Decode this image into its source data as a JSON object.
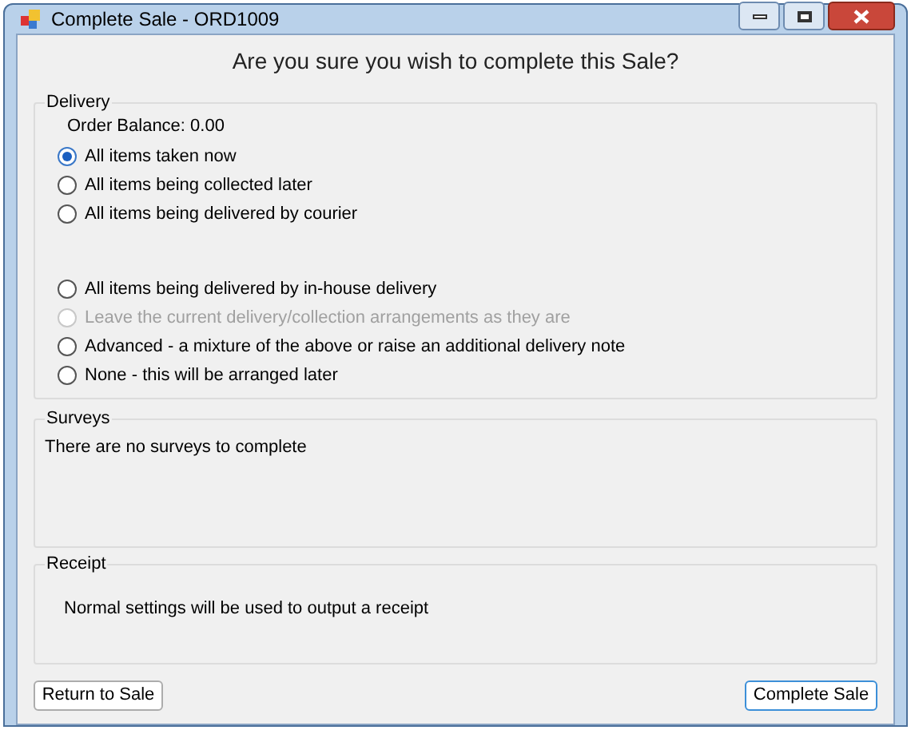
{
  "window": {
    "title": "Complete Sale - ORD1009"
  },
  "heading": "Are you sure you wish to complete this Sale?",
  "delivery": {
    "title": "Delivery",
    "balance": "Order Balance: 0.00",
    "option_groups": [
      [
        {
          "label": "All items taken now",
          "selected": true,
          "disabled": false
        },
        {
          "label": "All items being collected later",
          "selected": false,
          "disabled": false
        },
        {
          "label": "All items being delivered by courier",
          "selected": false,
          "disabled": false
        }
      ],
      [
        {
          "label": "All items being delivered by in-house delivery",
          "selected": false,
          "disabled": false
        },
        {
          "label": "Leave the current delivery/collection arrangements as they are",
          "selected": false,
          "disabled": true
        },
        {
          "label": "Advanced - a mixture of the above or raise an additional delivery note",
          "selected": false,
          "disabled": false
        },
        {
          "label": "None - this will be arranged later",
          "selected": false,
          "disabled": false
        }
      ]
    ]
  },
  "surveys": {
    "title": "Surveys",
    "message": "There are no surveys to complete"
  },
  "receipt": {
    "title": "Receipt",
    "message": "Normal settings will be used to output a receipt"
  },
  "buttons": [
    {
      "label": "Return to Sale",
      "default": false
    },
    {
      "label": "Complete Sale",
      "default": true
    }
  ]
}
